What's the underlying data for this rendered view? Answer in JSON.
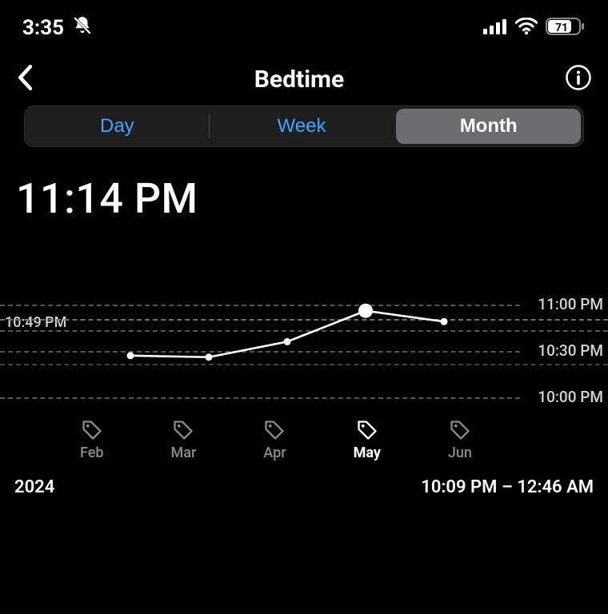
{
  "status_bar": {
    "time": "3:35",
    "battery_pct": "71"
  },
  "nav": {
    "title": "Bedtime"
  },
  "segments": {
    "day": "Day",
    "week": "Week",
    "month": "Month"
  },
  "headline_time": "11:14 PM",
  "y_left_label": "10:49 PM",
  "y_right": {
    "t11": "11:00 PM",
    "t1030": "10:30 PM",
    "t10": "10:00 PM"
  },
  "x_labels": [
    "Feb",
    "Mar",
    "Apr",
    "May",
    "Jun"
  ],
  "x_selected_index": 3,
  "footer": {
    "year": "2024",
    "range": "10:09 PM – 12:46 AM"
  },
  "chart_data": {
    "type": "line",
    "title": "Bedtime (Month)",
    "xlabel": "",
    "ylabel": "Bedtime",
    "y_ticks": [
      "10:00 PM",
      "10:30 PM",
      "11:00 PM"
    ],
    "y_reference": "10:49 PM",
    "categories": [
      "Feb",
      "Mar",
      "Apr",
      "May",
      "Jun"
    ],
    "values_minutes_past_10pm": [
      27,
      26,
      36,
      56,
      49
    ],
    "highlight_index": 3,
    "ylim": [
      0,
      60
    ],
    "grid": true
  }
}
